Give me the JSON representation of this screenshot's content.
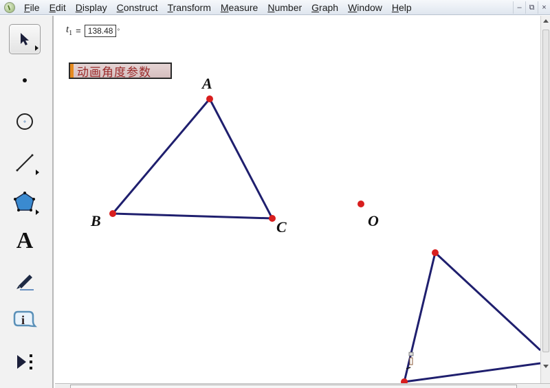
{
  "menubar": {
    "items": [
      {
        "label": "File",
        "mnemonic": "F"
      },
      {
        "label": "Edit",
        "mnemonic": "E"
      },
      {
        "label": "Display",
        "mnemonic": "D"
      },
      {
        "label": "Construct",
        "mnemonic": "C"
      },
      {
        "label": "Transform",
        "mnemonic": "T"
      },
      {
        "label": "Measure",
        "mnemonic": "M"
      },
      {
        "label": "Number",
        "mnemonic": "N"
      },
      {
        "label": "Graph",
        "mnemonic": "G"
      },
      {
        "label": "Window",
        "mnemonic": "W"
      },
      {
        "label": "Help",
        "mnemonic": "H"
      }
    ],
    "window_buttons": {
      "minimize": "–",
      "restore": "⧉",
      "close": "×"
    }
  },
  "toolbox": {
    "tools": [
      {
        "name": "selection-arrow-tool",
        "selected": true
      },
      {
        "name": "point-tool"
      },
      {
        "name": "compass-tool"
      },
      {
        "name": "straightedge-tool"
      },
      {
        "name": "polygon-tool"
      },
      {
        "name": "text-tool",
        "glyph": "A"
      },
      {
        "name": "marker-tool"
      },
      {
        "name": "information-tool",
        "glyph": "i"
      },
      {
        "name": "custom-tools"
      }
    ]
  },
  "canvas": {
    "parameter": {
      "name": "t",
      "subscript": "1",
      "equals": "=",
      "value": "138.48",
      "unit": "°"
    },
    "action_button": {
      "label": "动画角度参数",
      "accent": "#e58a1f"
    },
    "points": {
      "A": {
        "label": "A"
      },
      "B": {
        "label": "B"
      },
      "C": {
        "label": "C"
      },
      "O": {
        "label": "O"
      }
    },
    "colors": {
      "segment": "#1f1f6e",
      "point": "#d81e1e"
    }
  }
}
